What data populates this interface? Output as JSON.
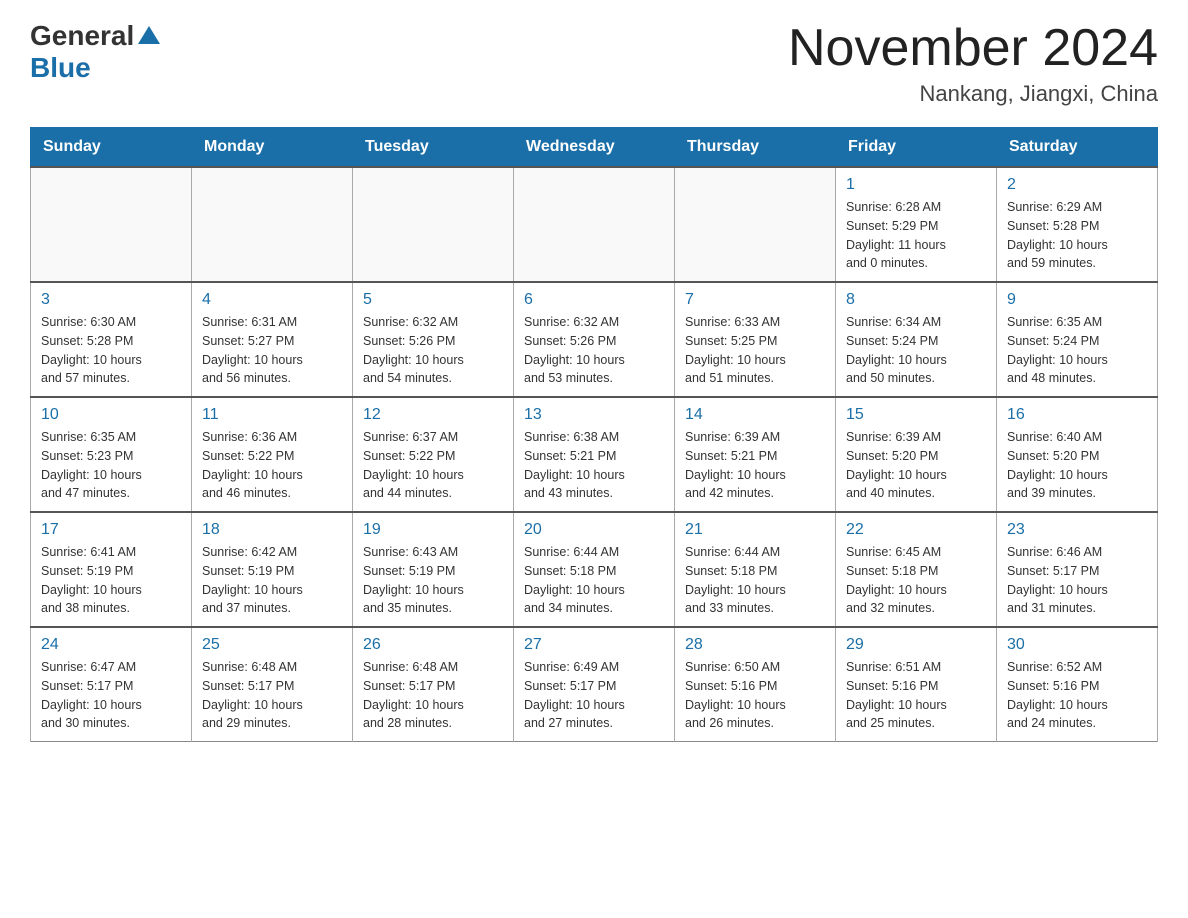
{
  "header": {
    "logo_general": "General",
    "logo_blue": "Blue",
    "month_title": "November 2024",
    "location": "Nankang, Jiangxi, China"
  },
  "days_of_week": [
    "Sunday",
    "Monday",
    "Tuesday",
    "Wednesday",
    "Thursday",
    "Friday",
    "Saturday"
  ],
  "weeks": [
    {
      "days": [
        {
          "number": "",
          "info": ""
        },
        {
          "number": "",
          "info": ""
        },
        {
          "number": "",
          "info": ""
        },
        {
          "number": "",
          "info": ""
        },
        {
          "number": "",
          "info": ""
        },
        {
          "number": "1",
          "info": "Sunrise: 6:28 AM\nSunset: 5:29 PM\nDaylight: 11 hours\nand 0 minutes."
        },
        {
          "number": "2",
          "info": "Sunrise: 6:29 AM\nSunset: 5:28 PM\nDaylight: 10 hours\nand 59 minutes."
        }
      ]
    },
    {
      "days": [
        {
          "number": "3",
          "info": "Sunrise: 6:30 AM\nSunset: 5:28 PM\nDaylight: 10 hours\nand 57 minutes."
        },
        {
          "number": "4",
          "info": "Sunrise: 6:31 AM\nSunset: 5:27 PM\nDaylight: 10 hours\nand 56 minutes."
        },
        {
          "number": "5",
          "info": "Sunrise: 6:32 AM\nSunset: 5:26 PM\nDaylight: 10 hours\nand 54 minutes."
        },
        {
          "number": "6",
          "info": "Sunrise: 6:32 AM\nSunset: 5:26 PM\nDaylight: 10 hours\nand 53 minutes."
        },
        {
          "number": "7",
          "info": "Sunrise: 6:33 AM\nSunset: 5:25 PM\nDaylight: 10 hours\nand 51 minutes."
        },
        {
          "number": "8",
          "info": "Sunrise: 6:34 AM\nSunset: 5:24 PM\nDaylight: 10 hours\nand 50 minutes."
        },
        {
          "number": "9",
          "info": "Sunrise: 6:35 AM\nSunset: 5:24 PM\nDaylight: 10 hours\nand 48 minutes."
        }
      ]
    },
    {
      "days": [
        {
          "number": "10",
          "info": "Sunrise: 6:35 AM\nSunset: 5:23 PM\nDaylight: 10 hours\nand 47 minutes."
        },
        {
          "number": "11",
          "info": "Sunrise: 6:36 AM\nSunset: 5:22 PM\nDaylight: 10 hours\nand 46 minutes."
        },
        {
          "number": "12",
          "info": "Sunrise: 6:37 AM\nSunset: 5:22 PM\nDaylight: 10 hours\nand 44 minutes."
        },
        {
          "number": "13",
          "info": "Sunrise: 6:38 AM\nSunset: 5:21 PM\nDaylight: 10 hours\nand 43 minutes."
        },
        {
          "number": "14",
          "info": "Sunrise: 6:39 AM\nSunset: 5:21 PM\nDaylight: 10 hours\nand 42 minutes."
        },
        {
          "number": "15",
          "info": "Sunrise: 6:39 AM\nSunset: 5:20 PM\nDaylight: 10 hours\nand 40 minutes."
        },
        {
          "number": "16",
          "info": "Sunrise: 6:40 AM\nSunset: 5:20 PM\nDaylight: 10 hours\nand 39 minutes."
        }
      ]
    },
    {
      "days": [
        {
          "number": "17",
          "info": "Sunrise: 6:41 AM\nSunset: 5:19 PM\nDaylight: 10 hours\nand 38 minutes."
        },
        {
          "number": "18",
          "info": "Sunrise: 6:42 AM\nSunset: 5:19 PM\nDaylight: 10 hours\nand 37 minutes."
        },
        {
          "number": "19",
          "info": "Sunrise: 6:43 AM\nSunset: 5:19 PM\nDaylight: 10 hours\nand 35 minutes."
        },
        {
          "number": "20",
          "info": "Sunrise: 6:44 AM\nSunset: 5:18 PM\nDaylight: 10 hours\nand 34 minutes."
        },
        {
          "number": "21",
          "info": "Sunrise: 6:44 AM\nSunset: 5:18 PM\nDaylight: 10 hours\nand 33 minutes."
        },
        {
          "number": "22",
          "info": "Sunrise: 6:45 AM\nSunset: 5:18 PM\nDaylight: 10 hours\nand 32 minutes."
        },
        {
          "number": "23",
          "info": "Sunrise: 6:46 AM\nSunset: 5:17 PM\nDaylight: 10 hours\nand 31 minutes."
        }
      ]
    },
    {
      "days": [
        {
          "number": "24",
          "info": "Sunrise: 6:47 AM\nSunset: 5:17 PM\nDaylight: 10 hours\nand 30 minutes."
        },
        {
          "number": "25",
          "info": "Sunrise: 6:48 AM\nSunset: 5:17 PM\nDaylight: 10 hours\nand 29 minutes."
        },
        {
          "number": "26",
          "info": "Sunrise: 6:48 AM\nSunset: 5:17 PM\nDaylight: 10 hours\nand 28 minutes."
        },
        {
          "number": "27",
          "info": "Sunrise: 6:49 AM\nSunset: 5:17 PM\nDaylight: 10 hours\nand 27 minutes."
        },
        {
          "number": "28",
          "info": "Sunrise: 6:50 AM\nSunset: 5:16 PM\nDaylight: 10 hours\nand 26 minutes."
        },
        {
          "number": "29",
          "info": "Sunrise: 6:51 AM\nSunset: 5:16 PM\nDaylight: 10 hours\nand 25 minutes."
        },
        {
          "number": "30",
          "info": "Sunrise: 6:52 AM\nSunset: 5:16 PM\nDaylight: 10 hours\nand 24 minutes."
        }
      ]
    }
  ]
}
